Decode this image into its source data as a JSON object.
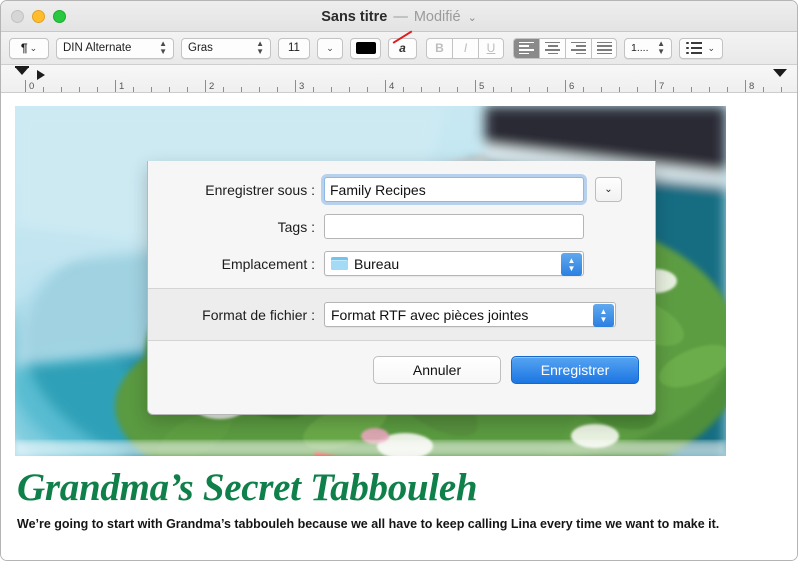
{
  "window": {
    "title_name": "Sans titre",
    "title_dash": "—",
    "title_modified": "Modifié",
    "title_chevron": "⌄"
  },
  "traffic_lights": {
    "close": "close-button",
    "minimize": "minimize-button",
    "maximize": "maximize-button"
  },
  "toolbar": {
    "paragraph_style": "¶",
    "paragraph_chevron": "⌄",
    "font_family": "DIN Alternate",
    "font_style": "Gras",
    "font_size": "11",
    "size_chevron": "⌄",
    "text_color": "#000000",
    "no_color_label": "a",
    "bold": "B",
    "italic": "I",
    "underline": "U",
    "list_number": "1....",
    "list_bullet_chevron": "⌄",
    "stepper_glyph": "⌃⌄"
  },
  "ruler": {
    "unit": "inches",
    "labels": [
      "0",
      "1",
      "2",
      "3",
      "4",
      "5",
      "6",
      "7",
      "8"
    ]
  },
  "document": {
    "headline": "Grandma’s Secret Tabbouleh",
    "headline_color": "#0f8049",
    "body_text": "We’re going to start with Grandma’s tabbouleh because we all have to keep calling Lina every time we want to make it.",
    "image_alt": "tabbouleh-salad-photo"
  },
  "save_dialog": {
    "save_as_label": "Enregistrer sous :",
    "save_as_value": "Family Recipes",
    "expand_chevron": "⌄",
    "tags_label": "Tags :",
    "tags_value": "",
    "location_label": "Emplacement :",
    "location_value": "Bureau",
    "file_format_label": "Format de fichier :",
    "file_format_value": "Format RTF avec pièces jointes",
    "cancel_label": "Annuler",
    "save_label": "Enregistrer",
    "stepper_up": "⌃",
    "stepper_down": "⌄",
    "accent_color": "#1c76e2"
  }
}
